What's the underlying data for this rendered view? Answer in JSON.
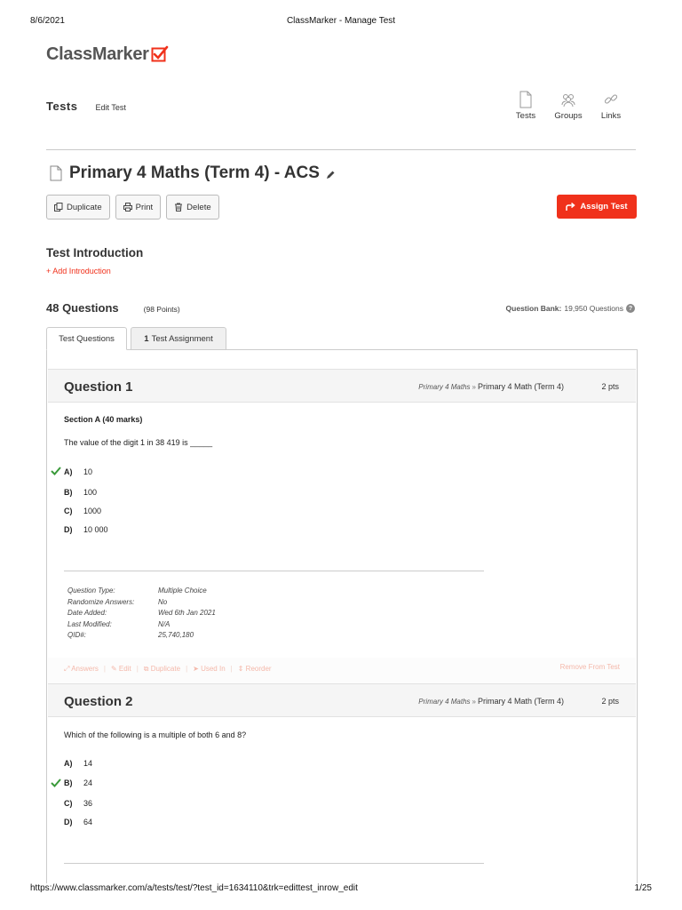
{
  "print": {
    "date": "8/6/2021",
    "title": "ClassMarker - Manage Test",
    "url": "https://www.classmarker.com/a/tests/test/?test_id=1634110&trk=edittest_inrow_edit",
    "page": "1/25"
  },
  "brand": {
    "name": "ClassMarker",
    "accent": "#f0311b"
  },
  "breadcrumb": {
    "main": "Tests",
    "sub": "Edit Test"
  },
  "topnav": [
    {
      "label": "Tests",
      "icon": "document-icon"
    },
    {
      "label": "Groups",
      "icon": "users-icon"
    },
    {
      "label": "Links",
      "icon": "link-icon"
    }
  ],
  "test": {
    "title": "Primary 4 Maths (Term 4) - ACS"
  },
  "actions": {
    "duplicate": "Duplicate",
    "print": "Print",
    "delete": "Delete",
    "assign": "Assign Test"
  },
  "intro": {
    "heading": "Test Introduction",
    "add": "+ Add Introduction"
  },
  "summary": {
    "questions": "48 Questions",
    "points": "(98 Points)",
    "bank_label": "Question Bank:",
    "bank_value": "19,950 Questions"
  },
  "tabs": [
    {
      "label": "Test Questions",
      "active": true
    },
    {
      "count": "1",
      "label": "Test Assignment",
      "active": false
    }
  ],
  "questions": [
    {
      "title": "Question 1",
      "category_parent": "Primary 4 Maths",
      "category_sep": "»",
      "category": "Primary 4 Math (Term 4)",
      "points": "2 pts",
      "section": "Section A (40 marks)",
      "text": "The value of the digit 1 in 38 419 is _____",
      "answers": [
        {
          "letter": "A)",
          "value": "10",
          "correct": true
        },
        {
          "letter": "B)",
          "value": "100",
          "correct": false
        },
        {
          "letter": "C)",
          "value": "1000",
          "correct": false
        },
        {
          "letter": "D)",
          "value": "10 000",
          "correct": false
        }
      ],
      "meta": [
        {
          "key": "Question Type:",
          "value": "Multiple Choice"
        },
        {
          "key": "Randomize Answers:",
          "value": "No"
        },
        {
          "key": "Date Added:",
          "value": "Wed 6th Jan 2021"
        },
        {
          "key": "Last Modified:",
          "value": "N/A"
        },
        {
          "key": "QID#:",
          "value": "25,740,180"
        }
      ],
      "actions": [
        "Answers",
        "Edit",
        "Duplicate",
        "Used In",
        "Reorder"
      ],
      "remove": "Remove From Test"
    },
    {
      "title": "Question 2",
      "category_parent": "Primary 4 Maths",
      "category_sep": "»",
      "category": "Primary 4 Math (Term 4)",
      "points": "2 pts",
      "text": "Which of the following is a multiple of both 6 and 8?",
      "answers": [
        {
          "letter": "A)",
          "value": "14",
          "correct": false
        },
        {
          "letter": "B)",
          "value": "24",
          "correct": true
        },
        {
          "letter": "C)",
          "value": "36",
          "correct": false
        },
        {
          "letter": "D)",
          "value": "64",
          "correct": false
        }
      ]
    }
  ]
}
